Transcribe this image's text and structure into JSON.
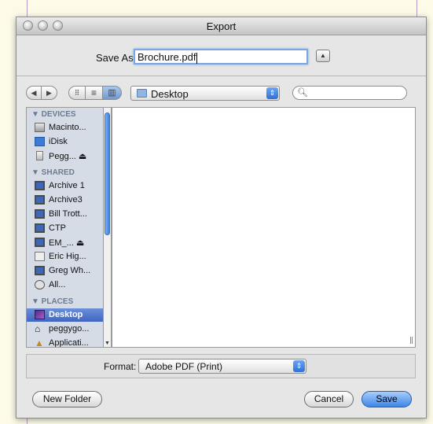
{
  "window": {
    "title": "Export"
  },
  "save": {
    "label": "Save As:",
    "filename": "Brochure.pdf",
    "expand_icon": "triangle-up-icon"
  },
  "toolbar": {
    "back_icon": "◀",
    "forward_icon": "▶",
    "view_icons": "⠿",
    "view_list": "≡",
    "view_columns": "▥",
    "location": "Desktop",
    "search_value": ""
  },
  "sidebar": {
    "devices_header": "▼ DEVICES",
    "devices": [
      {
        "label": "Macinto...",
        "icon": "hard-drive-icon"
      },
      {
        "label": "iDisk",
        "icon": "idisk-icon"
      },
      {
        "label": "Pegg... ⏏",
        "icon": "external-drive-icon"
      }
    ],
    "shared_header": "▼ SHARED",
    "shared": [
      {
        "label": "Archive 1",
        "icon": "monitor-icon"
      },
      {
        "label": "Archive3",
        "icon": "monitor-icon"
      },
      {
        "label": "Bill Trott...",
        "icon": "monitor-icon"
      },
      {
        "label": "CTP",
        "icon": "monitor-icon"
      },
      {
        "label": "EM_... ⏏",
        "icon": "monitor-icon"
      },
      {
        "label": "Eric Hig...",
        "icon": "pc-icon"
      },
      {
        "label": "Greg Wh...",
        "icon": "monitor-icon"
      },
      {
        "label": "All...",
        "icon": "network-icon"
      }
    ],
    "places_header": "▼ PLACES",
    "places": [
      {
        "label": "Desktop",
        "icon": "desktop-icon",
        "selected": true
      },
      {
        "label": "peggygo...",
        "icon": "home-icon"
      },
      {
        "label": "Applicati...",
        "icon": "applications-icon"
      }
    ]
  },
  "format": {
    "label": "Format:",
    "value": "Adobe PDF (Print)"
  },
  "buttons": {
    "new_folder": "New Folder",
    "cancel": "Cancel",
    "save": "Save"
  },
  "colors": {
    "selection": "#3e65c2",
    "default_button": "#3d86e8",
    "focus_ring": "#7aa7e4"
  }
}
